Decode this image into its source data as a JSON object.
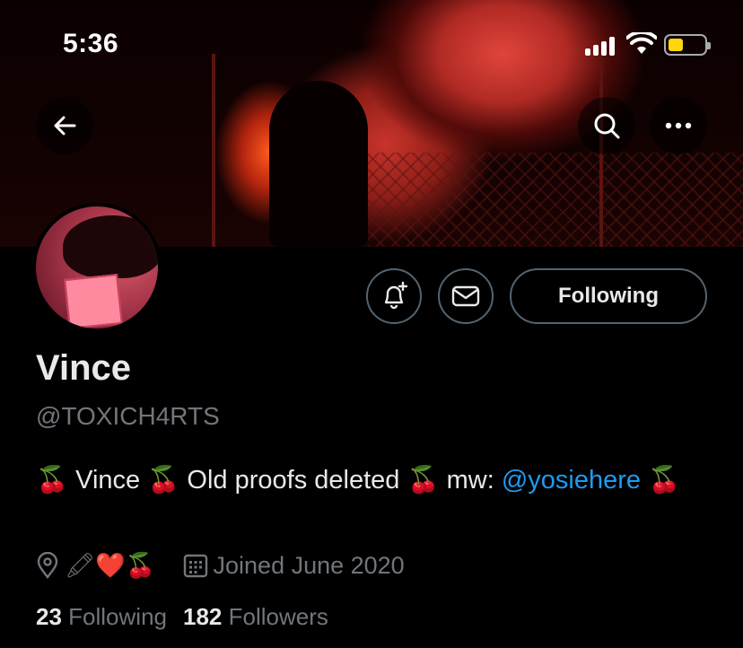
{
  "status_bar": {
    "time": "5:36"
  },
  "profile": {
    "name": "Vince",
    "handle": "@TOXICH4RTS",
    "bio_text": "🍒 Vince 🍒 Old proofs deleted 🍒 mw: ",
    "bio_mention": "@yosiehere",
    "bio_suffix": " 🍒",
    "location_emojis": "🖍❤️🍒",
    "joined": "Joined June 2020",
    "following_count": "23",
    "following_label": "Following",
    "followers_count": "182",
    "followers_label": "Followers"
  },
  "actions": {
    "follow_state": "Following"
  },
  "icons": [
    "back-arrow-icon",
    "search-icon",
    "more-icon",
    "bell-plus-icon",
    "mail-icon",
    "location-pin-icon",
    "calendar-icon"
  ],
  "colors": {
    "accent": "#1d9bf0",
    "secondary_text": "#71767b",
    "background": "#000000"
  }
}
